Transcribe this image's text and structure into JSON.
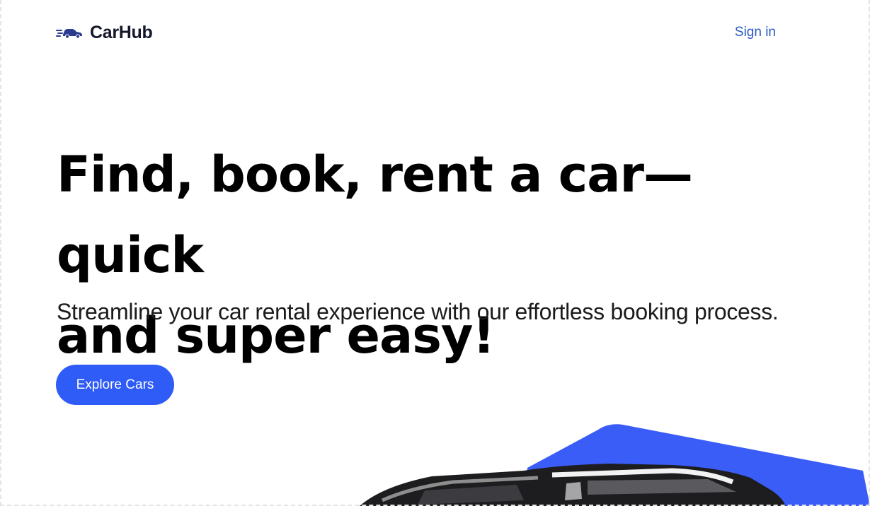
{
  "brand": {
    "name": "CarHub",
    "icon": "car-speed-icon",
    "accent": "#2f5cf7"
  },
  "nav": {
    "signin_label": "Sign in"
  },
  "hero": {
    "title_line1": "Find, book, rent a car—quick",
    "title_line2": "and super easy!",
    "subtitle": "Streamline your car rental experience with our effortless booking process.",
    "cta_label": "Explore Cars"
  }
}
